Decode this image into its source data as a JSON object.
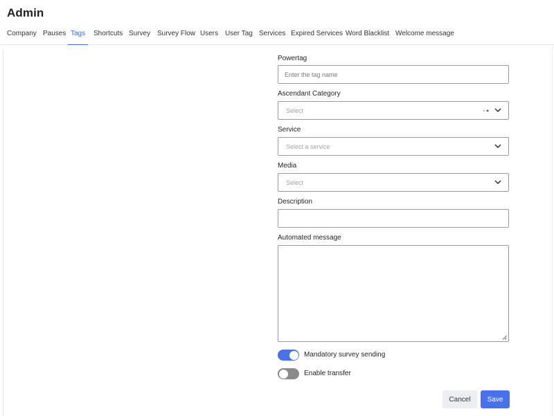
{
  "header": {
    "title": "Admin"
  },
  "tabs": [
    {
      "label": "Company"
    },
    {
      "label": "Pauses"
    },
    {
      "label": "Tags"
    },
    {
      "label": "Shortcuts"
    },
    {
      "label": "Survey"
    },
    {
      "label": "Survey Flow"
    },
    {
      "label": "Users"
    },
    {
      "label": "User Tag"
    },
    {
      "label": "Services"
    },
    {
      "label": "Expired Services"
    },
    {
      "label": "Word Blacklist"
    },
    {
      "label": "Welcome message"
    }
  ],
  "active_tab": "Tags",
  "form": {
    "powertag": {
      "label": "Powertag",
      "placeholder": "Enter the tag name"
    },
    "ascendant_category": {
      "label": "Ascendant Category",
      "placeholder": "Select"
    },
    "service": {
      "label": "Service",
      "placeholder": "Select a service"
    },
    "media": {
      "label": "Media",
      "placeholder": "Select"
    },
    "description": {
      "label": "Description",
      "value": ""
    },
    "automated_message": {
      "label": "Automated message",
      "value": ""
    },
    "mandatory_survey": {
      "label": "Mandatory survey sending",
      "enabled": true
    },
    "enable_transfer": {
      "label": "Enable transfer",
      "enabled": false
    }
  },
  "actions": {
    "cancel_label": "Cancel",
    "save_label": "Save"
  },
  "colors": {
    "accent": "#4a72e8",
    "active_tab": "#3a67d8",
    "toggle_off": "#8a8a8a",
    "cancel_bg": "#eceef3"
  }
}
